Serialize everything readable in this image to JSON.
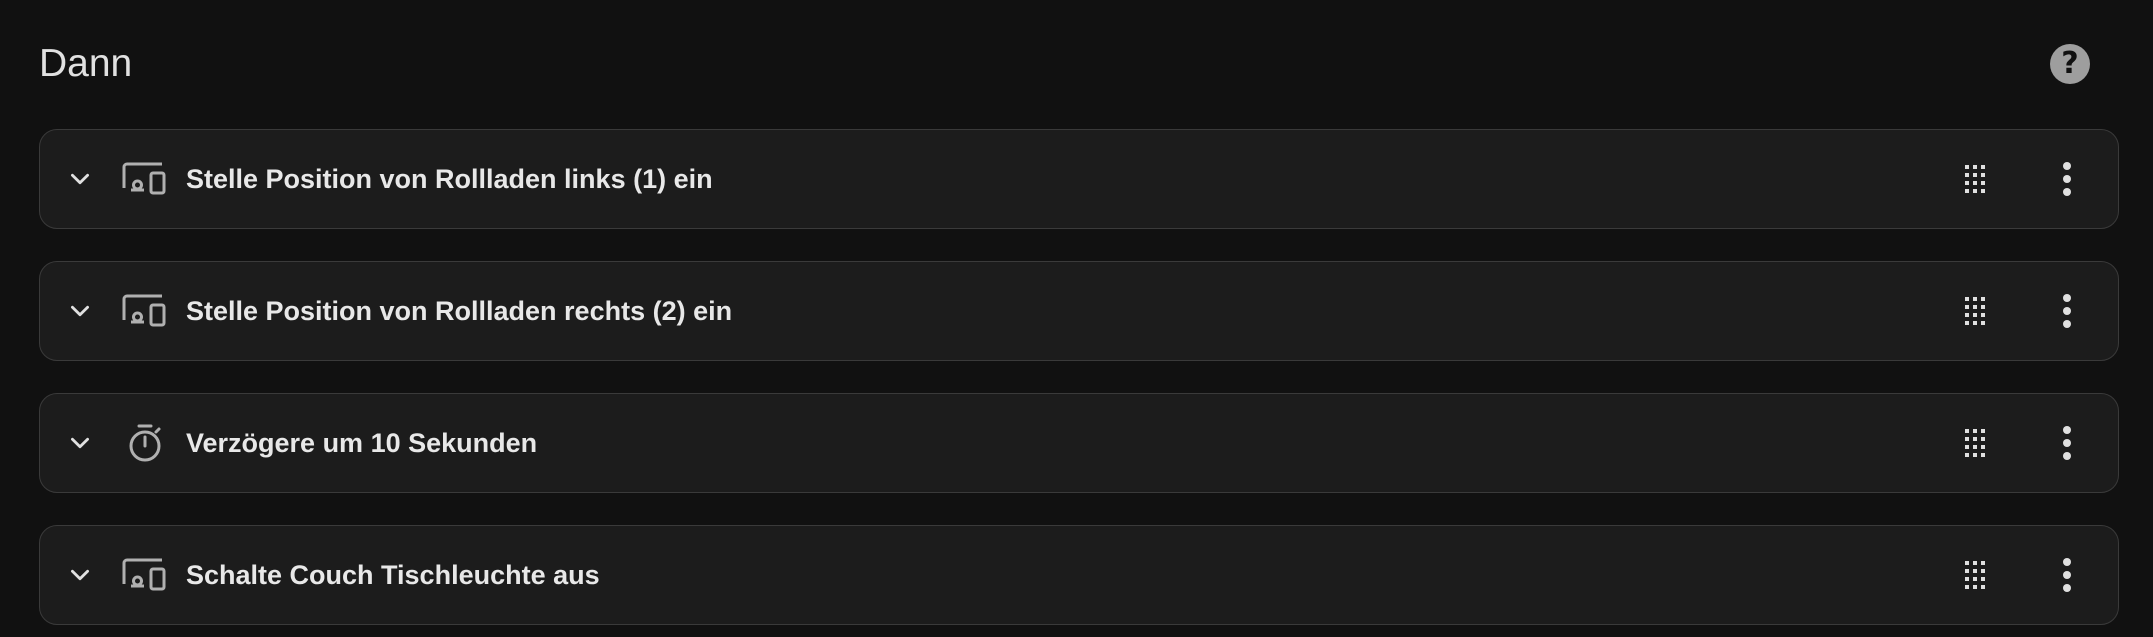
{
  "section": {
    "title": "Dann",
    "help_icon": "help-circle-icon"
  },
  "actions": [
    {
      "label": "Stelle Position von Rollladen links (1) ein",
      "icon": "devices-icon"
    },
    {
      "label": "Stelle Position von Rollladen rechts (2) ein",
      "icon": "devices-icon"
    },
    {
      "label": "Verzögere um 10 Sekunden",
      "icon": "timer-icon"
    },
    {
      "label": "Schalte Couch Tischleuchte aus",
      "icon": "devices-icon"
    }
  ],
  "colors": {
    "background": "#111111",
    "card_background": "#1c1c1c",
    "card_border": "#3a3a3a",
    "icon": "#b0b0b0",
    "text": "#e8e8e8"
  }
}
